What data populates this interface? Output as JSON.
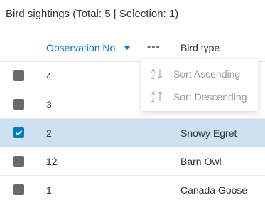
{
  "title": "Bird sightings (Total: 5 | Selection: 1)",
  "columns": {
    "observation": "Observation No.",
    "bird": "Bird type",
    "more_glyph": "•••"
  },
  "rows": [
    {
      "obs": "4",
      "bird": "",
      "selected": false
    },
    {
      "obs": "3",
      "bird": "",
      "selected": false
    },
    {
      "obs": "2",
      "bird": "Snowy Egret",
      "selected": true
    },
    {
      "obs": "12",
      "bird": "Barn Owl",
      "selected": false
    },
    {
      "obs": "1",
      "bird": "Canada Goose",
      "selected": false
    }
  ],
  "menu": {
    "sort_ascending": "Sort Ascending",
    "sort_descending": "Sort Descending",
    "ascending_icon": "sort-a-z-down-icon",
    "descending_icon": "sort-a-z-up-icon"
  },
  "colors": {
    "accent": "#007ac2",
    "selected_row": "#cfe1f1",
    "checkbox": "#6a6a6a"
  }
}
